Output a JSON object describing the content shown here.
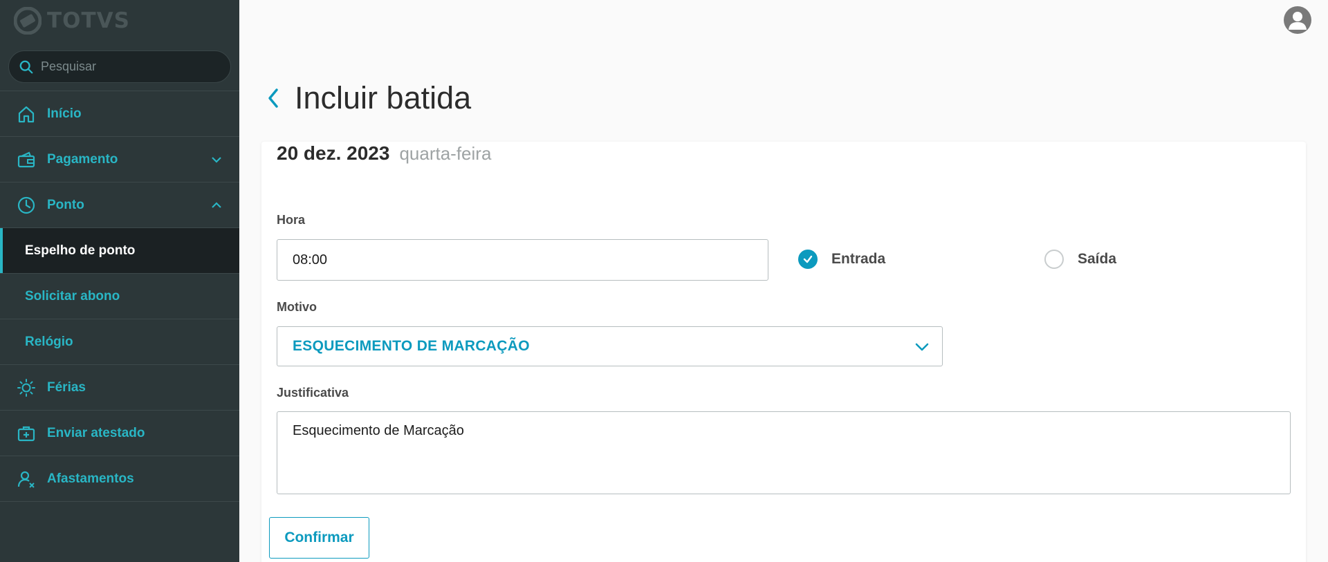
{
  "brand": {
    "logo_text": "TOTVS"
  },
  "search": {
    "placeholder": "Pesquisar"
  },
  "sidebar": {
    "items": [
      {
        "label": "Início",
        "icon": "home-icon"
      },
      {
        "label": "Pagamento",
        "icon": "wallet-icon",
        "expanded": false
      },
      {
        "label": "Ponto",
        "icon": "clock-icon",
        "expanded": true
      },
      {
        "label": "Espelho de ponto",
        "sub": true,
        "active": true
      },
      {
        "label": "Solicitar abono",
        "sub": true
      },
      {
        "label": "Relógio",
        "sub": true
      },
      {
        "label": "Férias",
        "icon": "sun-icon"
      },
      {
        "label": "Enviar atestado",
        "icon": "medical-kit-icon"
      },
      {
        "label": "Afastamentos",
        "icon": "user-x-icon"
      }
    ]
  },
  "header": {
    "title": "Incluir batida"
  },
  "form": {
    "date": "20 dez. 2023",
    "weekday": "quarta-feira",
    "hora_label": "Hora",
    "hora_value": "08:00",
    "radio_entrada": "Entrada",
    "radio_saida": "Saída",
    "selected_type": "Entrada",
    "motivo_label": "Motivo",
    "motivo_value": "ESQUECIMENTO DE MARCAÇÃO",
    "justificativa_label": "Justificativa",
    "justificativa_value": "Esquecimento de Marcação",
    "confirm_label": "Confirmar"
  },
  "colors": {
    "sidebar_bg": "#2c3739",
    "accent": "#29b6c5",
    "primary": "#0c9abe"
  }
}
